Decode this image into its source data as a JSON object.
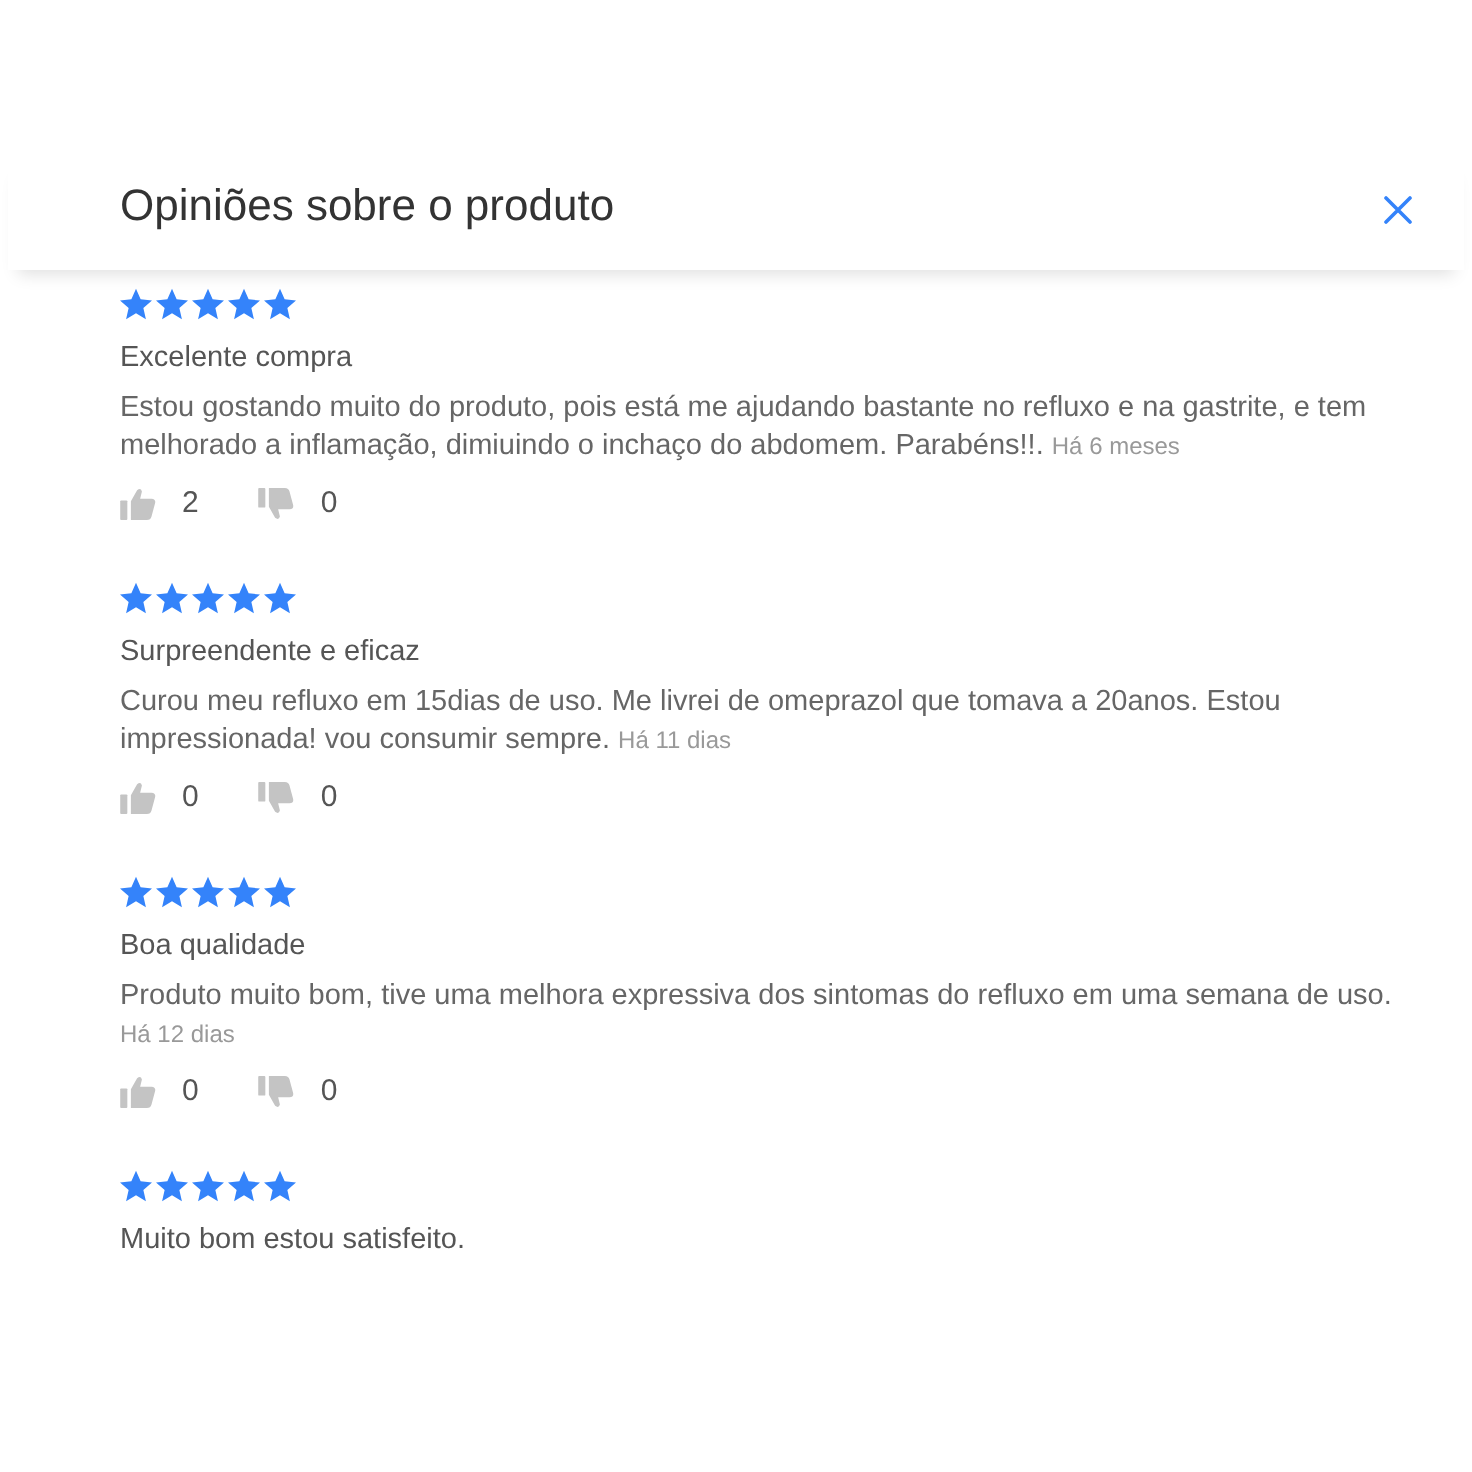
{
  "dialog": {
    "title": "Opiniões sobre o produto"
  },
  "reviews": [
    {
      "stars": 5,
      "title": "Excelente compra",
      "text": "Estou gostando muito do produto, pois está me ajudando bastante no refluxo e na gastrite, e tem melhorado a inflamação, dimiuindo o inchaço do abdomem. Parabéns!!.",
      "date": "Há 6 meses",
      "likes": "2",
      "dislikes": "0"
    },
    {
      "stars": 5,
      "title": "Surpreendente e eficaz",
      "text": "Curou meu refluxo em 15dias de uso. Me livrei de omeprazol que tomava a 20anos. Estou impressionada! vou consumir sempre.",
      "date": "Há 11 dias",
      "likes": "0",
      "dislikes": "0"
    },
    {
      "stars": 5,
      "title": "Boa qualidade",
      "text": "Produto muito bom, tive uma melhora expressiva dos sintomas do refluxo em uma semana de uso.",
      "date": "Há 12 dias",
      "likes": "0",
      "dislikes": "0"
    },
    {
      "stars": 5,
      "title": "Muito bom estou satisfeito."
    }
  ]
}
